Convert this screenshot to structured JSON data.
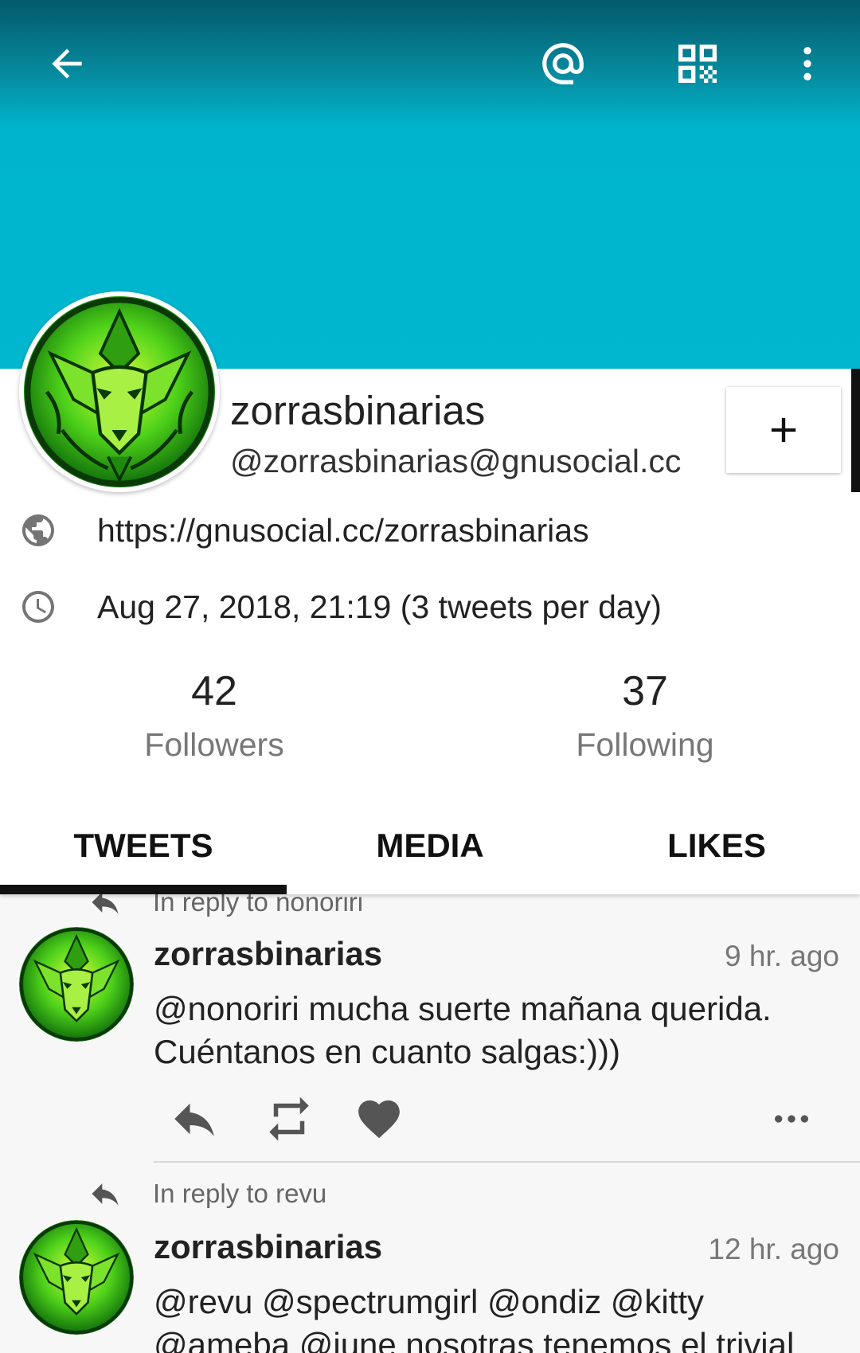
{
  "toolbar": {
    "icons": [
      "back-arrow-icon",
      "mention-at-icon",
      "qr-code-icon",
      "overflow-menu-icon"
    ]
  },
  "profile": {
    "display_name": "zorrasbinarias",
    "screen_name": "@zorrasbinarias@gnusocial.cc",
    "url": "https://gnusocial.cc/zorrasbinarias",
    "joined": "Aug 27, 2018, 21:19 (3 tweets per day)",
    "follow_button": "+",
    "followers_count": "42",
    "followers_label": "Followers",
    "following_count": "37",
    "following_label": "Following"
  },
  "tabs": [
    {
      "label": "TWEETS",
      "active": true
    },
    {
      "label": "MEDIA",
      "active": false
    },
    {
      "label": "LIKES",
      "active": false
    }
  ],
  "tweets": [
    {
      "reply_to": "In reply to nonoriri",
      "author": "zorrasbinarias",
      "time": "9 hr. ago",
      "text": "@nonoriri mucha suerte mañana querida. Cuéntanos en cuanto salgas:)))"
    },
    {
      "reply_to": "In reply to revu",
      "author": "zorrasbinarias",
      "time": "12 hr. ago",
      "text": "@revu @spectrumgirl @ondiz @kitty @ameba @june nosotras tenemos el trivial"
    }
  ],
  "colors": {
    "banner": "#00b7cf",
    "accent_dark": "#111111"
  }
}
